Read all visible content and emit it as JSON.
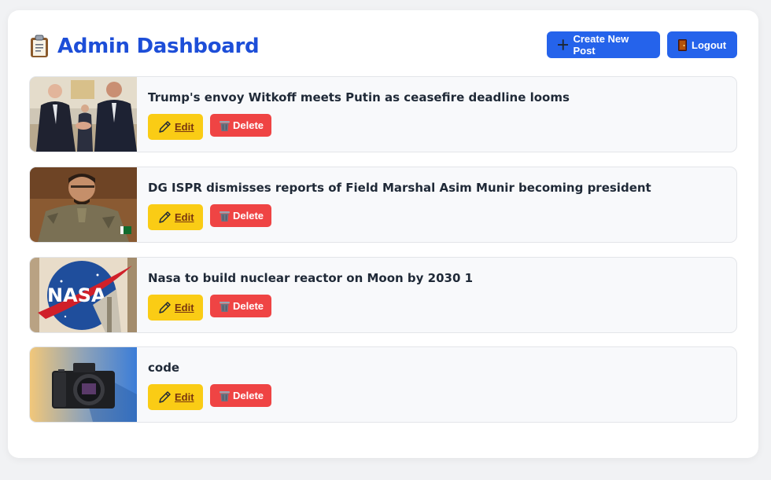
{
  "header": {
    "title": "Admin Dashboard",
    "title_icon": "clipboard-icon",
    "create_label": "Create New Post",
    "create_icon": "plus-icon",
    "logout_label": "Logout",
    "logout_icon": "door-icon"
  },
  "posts": [
    {
      "title": "Trump's envoy Witkoff meets Putin as ceasefire deadline looms",
      "edit_label": "Edit",
      "delete_label": "Delete",
      "thumbnail": "handshake-photo"
    },
    {
      "title": "DG ISPR dismisses reports of Field Marshal Asim Munir becoming president",
      "edit_label": "Edit",
      "delete_label": "Delete",
      "thumbnail": "military-officer-photo"
    },
    {
      "title": "Nasa to build nuclear reactor on Moon by 2030 1",
      "edit_label": "Edit",
      "delete_label": "Delete",
      "thumbnail": "nasa-logo-photo"
    },
    {
      "title": "code",
      "edit_label": "Edit",
      "delete_label": "Delete",
      "thumbnail": "camera-photo"
    }
  ],
  "colors": {
    "primary": "#2563eb",
    "title": "#1d4ed8",
    "edit": "#facc15",
    "delete": "#ef4444"
  }
}
